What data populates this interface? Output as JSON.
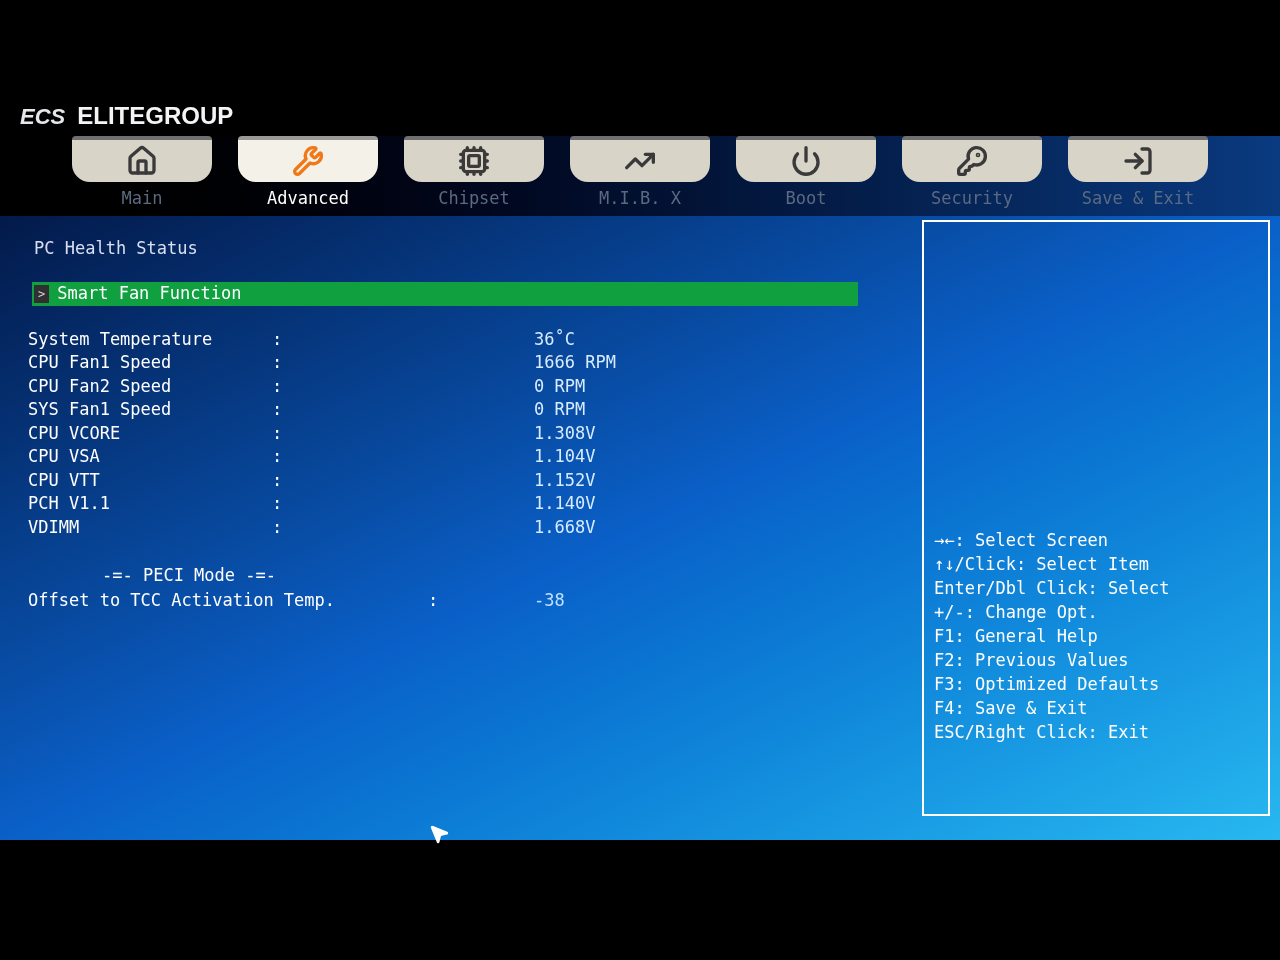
{
  "logo": {
    "mark": "ECS",
    "brand": "ELITEGROUP"
  },
  "tabs": [
    {
      "label": "Main",
      "selected": false
    },
    {
      "label": "Advanced",
      "selected": true
    },
    {
      "label": "Chipset",
      "selected": false
    },
    {
      "label": "M.I.B. X",
      "selected": false
    },
    {
      "label": "Boot",
      "selected": false
    },
    {
      "label": "Security",
      "selected": false
    },
    {
      "label": "Save & Exit",
      "selected": false
    }
  ],
  "page_title": "PC Health Status",
  "submenu": {
    "marker": ">",
    "label": "Smart Fan Function",
    "selected": true
  },
  "readings": [
    {
      "label": "System Temperature",
      "colon": ":",
      "value": "36˚C"
    },
    {
      "label": "CPU Fan1 Speed",
      "colon": ":",
      "value": "1666 RPM"
    },
    {
      "label": "CPU Fan2 Speed",
      "colon": ":",
      "value": "0 RPM"
    },
    {
      "label": "SYS Fan1 Speed",
      "colon": ":",
      "value": "0 RPM"
    },
    {
      "label": "CPU VCORE",
      "colon": ":",
      "value": "1.308V"
    },
    {
      "label": "CPU VSA",
      "colon": ":",
      "value": "1.104V"
    },
    {
      "label": "CPU VTT",
      "colon": ":",
      "value": "1.152V"
    },
    {
      "label": "PCH V1.1",
      "colon": ":",
      "value": "1.140V"
    },
    {
      "label": "VDIMM",
      "colon": ":",
      "value": "1.668V"
    }
  ],
  "peci": {
    "heading": "-=- PECI Mode -=-",
    "label": "Offset to TCC Activation Temp.",
    "colon": ":",
    "value": "-38"
  },
  "help": [
    "→←: Select Screen",
    "↑↓/Click: Select Item",
    "Enter/Dbl Click: Select",
    "+/-: Change Opt.",
    "F1: General Help",
    "F2: Previous Values",
    "F3: Optimized Defaults",
    "F4: Save & Exit",
    "ESC/Right Click: Exit"
  ]
}
